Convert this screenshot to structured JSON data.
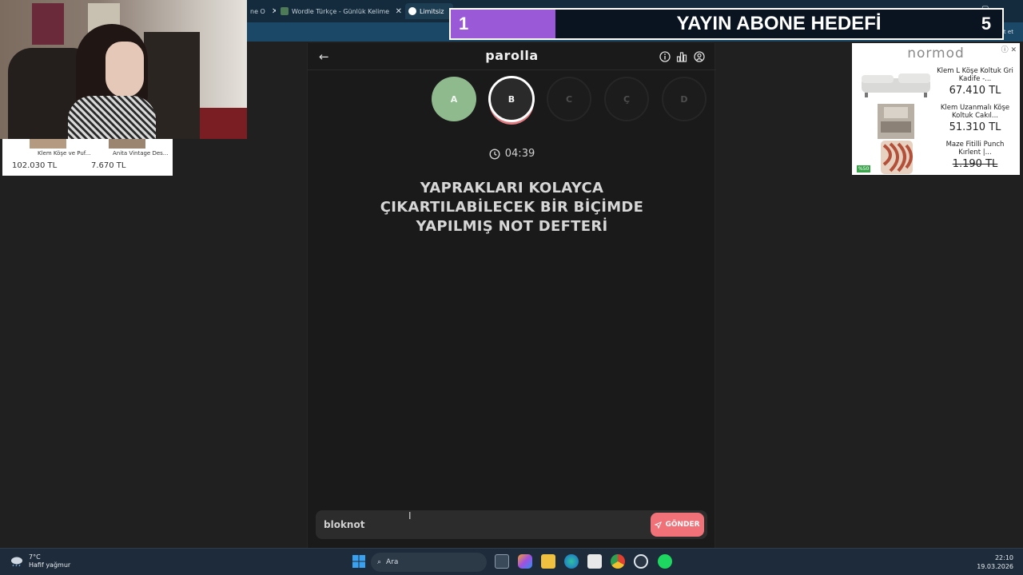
{
  "browser": {
    "tabs": [
      {
        "label": "ne O",
        "active": false
      },
      {
        "label": "Wordle Türkçe - Günlük Kelime O",
        "active": false
      },
      {
        "label": "Limitsiz",
        "active": true
      }
    ],
    "chat_label": "Sohbet et"
  },
  "overlay": {
    "current": "1",
    "title": "YAYIN ABONE HEDEFİ",
    "target": "5",
    "progress_fraction": 0.2
  },
  "left_ad": {
    "items": [
      {
        "caption": "Klem Köşe ve Puf...",
        "price": "102.030 TL"
      },
      {
        "caption": "Anita Vintage Des...",
        "price": "7.670 TL"
      }
    ]
  },
  "right_ad": {
    "brand": "normod",
    "products": [
      {
        "name": "Klem L Köşe Koltuk Gri Kadife -...",
        "price": "67.410 TL",
        "strike": false
      },
      {
        "name": "Klem Uzanmalı Köşe Koltuk Cakıl...",
        "price": "51.310 TL",
        "strike": false
      },
      {
        "name": "Maze Fitilli Punch Kırlent |...",
        "price": "1.190 TL",
        "strike": true
      }
    ],
    "badge": "%50"
  },
  "app": {
    "title": "parolla",
    "letters": [
      {
        "letter": "A",
        "state": "done"
      },
      {
        "letter": "B",
        "state": "current"
      },
      {
        "letter": "C",
        "state": "pending"
      },
      {
        "letter": "Ç",
        "state": "pending"
      },
      {
        "letter": "D",
        "state": "pending"
      }
    ],
    "timer": "04:39",
    "clue_lines": [
      "YAPRAKLARI KOLAYCA",
      "ÇIKARTILABİLECEK BİR BİÇİMDE",
      "YAPILMIŞ NOT DEFTERİ"
    ],
    "answer_value": "bloknot",
    "send_label": "GÖNDER"
  },
  "taskbar": {
    "weather_temp": "7°C",
    "weather_desc": "Hafif yağmur",
    "search_label": "Ara",
    "time": "22:10",
    "date": "19.03.2026"
  },
  "colors": {
    "done": "#8fba8e",
    "current_ring": "#ffffff",
    "send_button": "#f07177",
    "overlay_fill": "#9a5ad8"
  }
}
